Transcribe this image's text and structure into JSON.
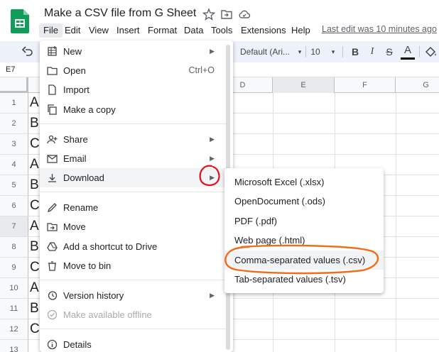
{
  "app": {
    "doc_title": "Make a CSV file from G Sheet",
    "last_edit": "Last edit was 10 minutes ago",
    "brand_color": "#0f9d58"
  },
  "menubar": {
    "items": [
      "File",
      "Edit",
      "View",
      "Insert",
      "Format",
      "Data",
      "Tools",
      "Extensions",
      "Help"
    ]
  },
  "toolbar": {
    "font": "Default (Ari...",
    "font_size": "10",
    "bold": "B",
    "italic": "I",
    "strike": "S",
    "text_color": "A"
  },
  "namebox": {
    "cell": "E7"
  },
  "grid": {
    "columns": [
      "D",
      "E",
      "F",
      "G"
    ],
    "rows": [
      "1",
      "2",
      "3",
      "4",
      "5",
      "6",
      "7",
      "8",
      "9",
      "10",
      "11",
      "12",
      "13"
    ],
    "col_a_values": [
      "A",
      "B",
      "C",
      "A",
      "B",
      "C",
      "A",
      "B",
      "C",
      "A",
      "B",
      "C",
      ""
    ]
  },
  "file_menu": {
    "items": [
      {
        "label": "New",
        "icon": "new-sheet-icon",
        "arrow": true
      },
      {
        "label": "Open",
        "icon": "folder-open-icon",
        "shortcut": "Ctrl+O"
      },
      {
        "label": "Import",
        "icon": "file-import-icon"
      },
      {
        "label": "Make a copy",
        "icon": "copy-icon"
      },
      {
        "label": "Share",
        "icon": "share-icon",
        "arrow": true
      },
      {
        "label": "Email",
        "icon": "email-icon",
        "arrow": true
      },
      {
        "label": "Download",
        "icon": "download-icon",
        "arrow": true
      },
      {
        "label": "Rename",
        "icon": "rename-icon"
      },
      {
        "label": "Move",
        "icon": "move-icon"
      },
      {
        "label": "Add a shortcut to Drive",
        "icon": "drive-shortcut-icon"
      },
      {
        "label": "Move to bin",
        "icon": "trash-icon"
      },
      {
        "label": "Version history",
        "icon": "history-icon",
        "arrow": true
      },
      {
        "label": "Make available offline",
        "icon": "offline-icon",
        "disabled": true
      },
      {
        "label": "Details",
        "icon": "info-icon"
      }
    ]
  },
  "download_submenu": {
    "items": [
      "Microsoft Excel (.xlsx)",
      "OpenDocument (.ods)",
      "PDF (.pdf)",
      "Web page (.html)",
      "Comma-separated values (.csv)",
      "Tab-separated values (.tsv)"
    ]
  },
  "annotations": {
    "arrow_circle_color": "#e0101e",
    "csv_oval_color": "#ef6c1a"
  }
}
